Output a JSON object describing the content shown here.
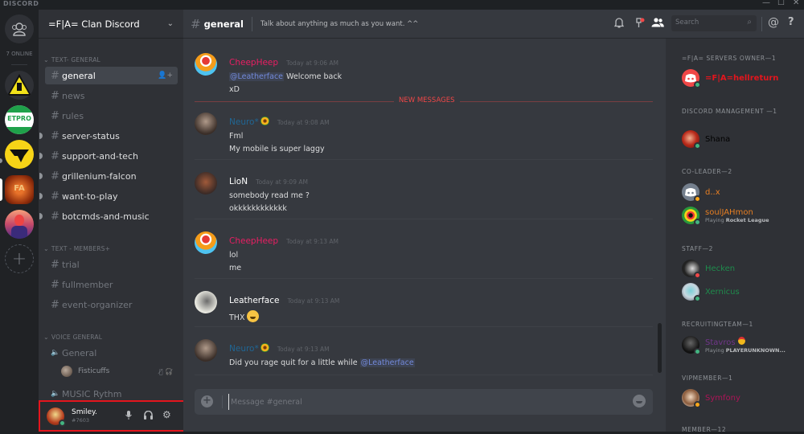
{
  "titlebar": {
    "brand": "DISCORD",
    "minimize": "—",
    "maximize": "☐",
    "close": "✕"
  },
  "guilds": {
    "online_count": "7 ONLINE",
    "servers": [
      {
        "name": "warning-server",
        "label": ""
      },
      {
        "name": "etpro-server",
        "label": "ETPRO"
      },
      {
        "name": "wu-server",
        "label": ""
      },
      {
        "name": "fa-clan-server",
        "label": "FA"
      },
      {
        "name": "hero-server",
        "label": ""
      }
    ],
    "add_server": "+"
  },
  "server": {
    "name": "=F|A= Clan Discord",
    "categories": [
      {
        "label": "TEXT- GENERAL"
      },
      {
        "label": "TEXT - MEMBERS+"
      },
      {
        "label": "VOICE GENERAL"
      }
    ],
    "text_general": [
      {
        "name": "general",
        "state": "active"
      },
      {
        "name": "news",
        "state": "read"
      },
      {
        "name": "rules",
        "state": "read"
      },
      {
        "name": "server-status",
        "state": "unread"
      },
      {
        "name": "support-and-tech",
        "state": "unread"
      },
      {
        "name": "grillenium-falcon",
        "state": "unread"
      },
      {
        "name": "want-to-play",
        "state": "unread"
      },
      {
        "name": "botcmds-and-music",
        "state": "unread"
      }
    ],
    "text_members": [
      {
        "name": "trial"
      },
      {
        "name": "fullmember"
      },
      {
        "name": "event-organizer"
      }
    ],
    "voice": [
      {
        "name": "General",
        "users": [
          {
            "name": "Fisticuffs"
          }
        ]
      },
      {
        "name": "MUSIC Rythm",
        "users": []
      }
    ]
  },
  "user_panel": {
    "username": "Smiley.",
    "discriminator": "#7603",
    "status": "online"
  },
  "chat": {
    "channel": "general",
    "topic": "Talk about anything as much as you want. ^^",
    "search_placeholder": "Search",
    "composer_placeholder": "Message #general",
    "new_messages_label": "NEW MESSAGES",
    "messages": [
      {
        "author": "CheepHeep",
        "color": "#e91e63",
        "timestamp": "Today at 9:06 AM",
        "lines": [
          {
            "mention": "@Leatherface",
            "text": " Welcome back"
          },
          {
            "text": "xD"
          }
        ]
      },
      {
        "author": "Neuro*",
        "color": "#206694",
        "timestamp": "Today at 9:08 AM",
        "lines": [
          {
            "text": "Fml"
          },
          {
            "text": "My mobile is super laggy"
          }
        ]
      },
      {
        "author": "LioN",
        "color": "#ffffff",
        "timestamp": "Today at 9:09 AM",
        "lines": [
          {
            "text": "somebody  read me ?"
          },
          {
            "text": "okkkkkkkkkkkk"
          }
        ]
      },
      {
        "author": "CheepHeep",
        "color": "#e91e63",
        "timestamp": "Today at 9:13 AM",
        "lines": [
          {
            "text": "lol"
          },
          {
            "text": "me"
          }
        ]
      },
      {
        "author": "Leatherface",
        "color": "#ffffff",
        "timestamp": "Today at 9:13 AM",
        "lines": [
          {
            "text": "THX"
          }
        ]
      },
      {
        "author": "Neuro*",
        "color": "#206694",
        "timestamp": "Today at 9:13 AM",
        "lines": [
          {
            "text": "Did you rage quit for a little while ",
            "mention": "@Leatherface"
          }
        ]
      }
    ]
  },
  "members": {
    "groups": [
      {
        "role": "=F|A= SERVERS OWNER—1",
        "members": [
          {
            "name": "=F|A=hellreturn",
            "color": "#e4151d",
            "status": "online"
          }
        ]
      },
      {
        "role": "DISCORD MANAGEMENT —1",
        "members": [
          {
            "name": "Shana",
            "color": "#000000",
            "status": "online"
          }
        ]
      },
      {
        "role": "CO-LEADER—2",
        "members": [
          {
            "name": "d..x",
            "color": "#e67e22",
            "status": "idle"
          },
          {
            "name": "soulJAHmon",
            "color": "#e67e22",
            "status": "online",
            "activity_prefix": "Playing ",
            "activity": "Rocket League"
          }
        ]
      },
      {
        "role": "STAFF—2",
        "members": [
          {
            "name": "Hecken",
            "color": "#1f8b4c",
            "status": "dnd"
          },
          {
            "name": "Xernicus",
            "color": "#1f8b4c",
            "status": "online"
          }
        ]
      },
      {
        "role": "RECRUITINGTEAM—1",
        "members": [
          {
            "name": "Stavros",
            "color": "#71368a",
            "status": "online",
            "activity_prefix": "Playing ",
            "activity": "PLAYERUNKNOWN..."
          }
        ]
      },
      {
        "role": "VIPMEMBER—1",
        "members": [
          {
            "name": "Symfony",
            "color": "#ad1457",
            "status": "idle"
          }
        ]
      },
      {
        "role": "MEMBER—12",
        "members": []
      }
    ]
  },
  "colors": {
    "accent": "#7289da",
    "online": "#43b581",
    "idle": "#faa61a",
    "dnd": "#f04747",
    "highlight_box": "#e4151d"
  }
}
